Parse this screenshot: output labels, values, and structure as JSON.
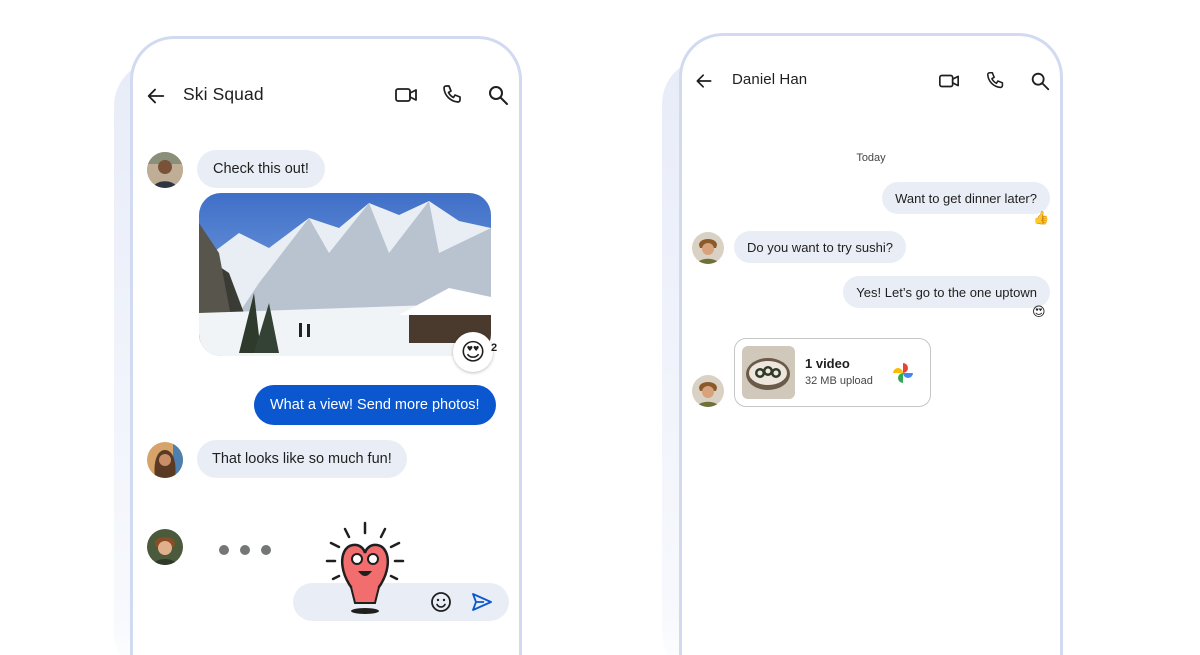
{
  "left_phone": {
    "title": "Ski Squad",
    "icons": [
      "back-arrow-icon",
      "video-call-icon",
      "phone-icon",
      "search-icon"
    ],
    "messages": [
      {
        "type": "incoming",
        "text": "Check this out!"
      },
      {
        "type": "image",
        "reaction": "😍",
        "reaction_count": "2"
      },
      {
        "type": "outgoing",
        "text": "What a view! Send more photos!"
      },
      {
        "type": "incoming",
        "text": "That looks like so much fun!"
      }
    ],
    "typing_indicator": "typing",
    "composer": {
      "icons": [
        "emoji-icon",
        "send-icon"
      ]
    }
  },
  "right_phone": {
    "title": "Daniel Han",
    "icons": [
      "back-arrow-icon",
      "video-call-icon",
      "phone-icon",
      "search-icon"
    ],
    "date_separator": "Today",
    "messages": [
      {
        "type": "outgoing",
        "text": "Want to get dinner later?",
        "reaction": "👍"
      },
      {
        "type": "incoming",
        "text": "Do you want to try sushi?"
      },
      {
        "type": "outgoing",
        "text": "Yes! Let’s go to the one uptown",
        "reaction": "😍"
      }
    ],
    "attachment": {
      "title": "1 video",
      "subtitle": "32 MB upload"
    }
  },
  "colors": {
    "accent": "#0b57d0",
    "bubble": "#e9eef6",
    "frame": "#d2daf2"
  }
}
